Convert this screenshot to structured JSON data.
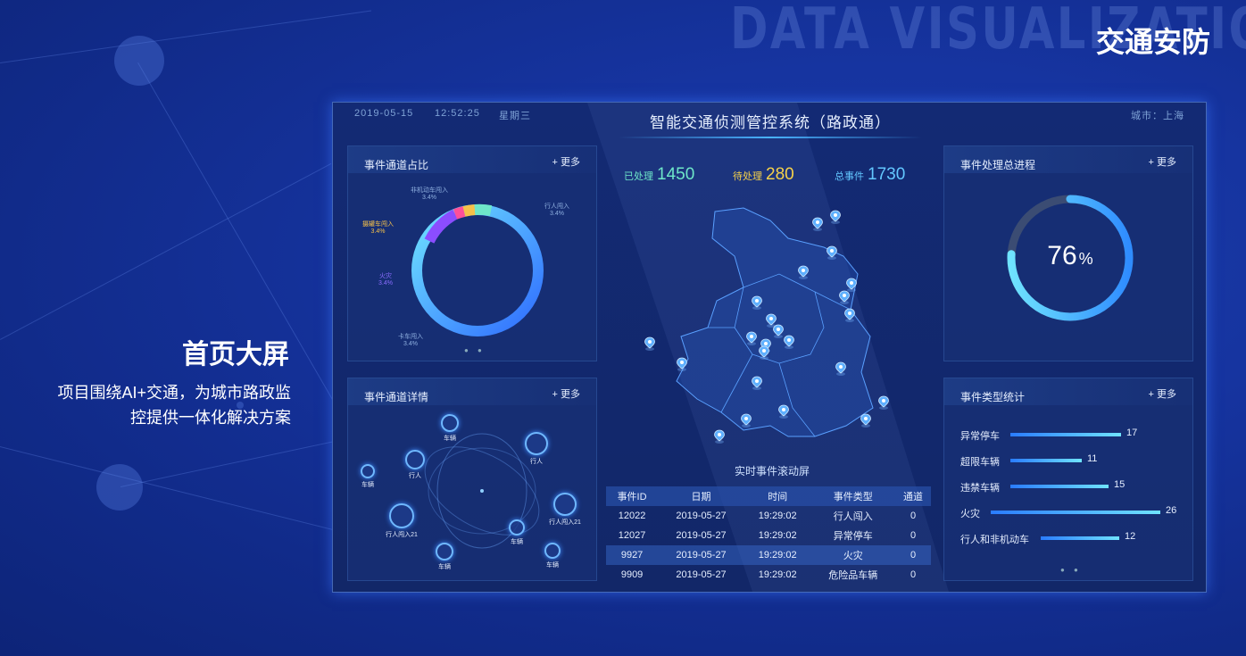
{
  "background_word": "DATA VISUALIZATION",
  "section_tag": "交通安防",
  "slide": {
    "title": "首页大屏",
    "description": "项目围绕AI+交通，为城市路政监控提供一体化解决方案"
  },
  "dashboard": {
    "date": "2019-05-15",
    "time": "12:52:25",
    "weekday": "星期三",
    "title": "智能交通侦测管控系统（路政通）",
    "city": "城市：上海",
    "stats": [
      {
        "label": "已处理",
        "value": "1450",
        "color": "#6ee7c9"
      },
      {
        "label": "待处理",
        "value": "280",
        "color": "#f5d14a"
      },
      {
        "label": "总事件",
        "value": "1730",
        "color": "#63c8ff"
      }
    ],
    "channel_ratio": {
      "title": "事件通道占比",
      "more": "+ 更多",
      "labels": [
        {
          "name": "非机动车闯入",
          "pct": "3.4%"
        },
        {
          "name": "行人闯入",
          "pct": "3.4%"
        },
        {
          "name": "摄罐车闯入",
          "pct": "3.4%"
        },
        {
          "name": "火灾",
          "pct": "3.4%"
        },
        {
          "name": "卡车闯入",
          "pct": "3.4%"
        }
      ]
    },
    "channel_detail": {
      "title": "事件通道详情",
      "more": "+ 更多",
      "nodes": [
        "车辆",
        "行人",
        "行人",
        "车辆",
        "行人闯入21",
        "行人闯入21",
        "车辆",
        "车辆",
        "车辆"
      ]
    },
    "progress": {
      "title": "事件处理总进程",
      "more": "+ 更多",
      "value": "76",
      "unit": "%",
      "fraction": 0.76
    },
    "type_stats": {
      "title": "事件类型统计",
      "more": "+ 更多",
      "items": [
        {
          "label": "异常停车",
          "value": "17"
        },
        {
          "label": "超限车辆",
          "value": "11"
        },
        {
          "label": "违禁车辆",
          "value": "15"
        },
        {
          "label": "火灾",
          "value": "26"
        },
        {
          "label": "行人和非机动车",
          "value": "12"
        }
      ]
    },
    "ticker": {
      "title": "实时事件滚动屏",
      "headers": [
        "事件ID",
        "日期",
        "时间",
        "事件类型",
        "通道"
      ],
      "rows": [
        [
          "12022",
          "2019-05-27",
          "19:29:02",
          "行人闯入",
          "0"
        ],
        [
          "12027",
          "2019-05-27",
          "19:29:02",
          "异常停车",
          "0"
        ],
        [
          "9927",
          "2019-05-27",
          "19:29:02",
          "火灾",
          "0"
        ],
        [
          "9909",
          "2019-05-27",
          "19:29:02",
          "危险品车辆",
          "0"
        ]
      ],
      "highlight_row": 2
    }
  },
  "colors": {
    "accent": "#49b3ff",
    "ring_start": "#2f6cff",
    "ring_end": "#6fe3ff"
  }
}
